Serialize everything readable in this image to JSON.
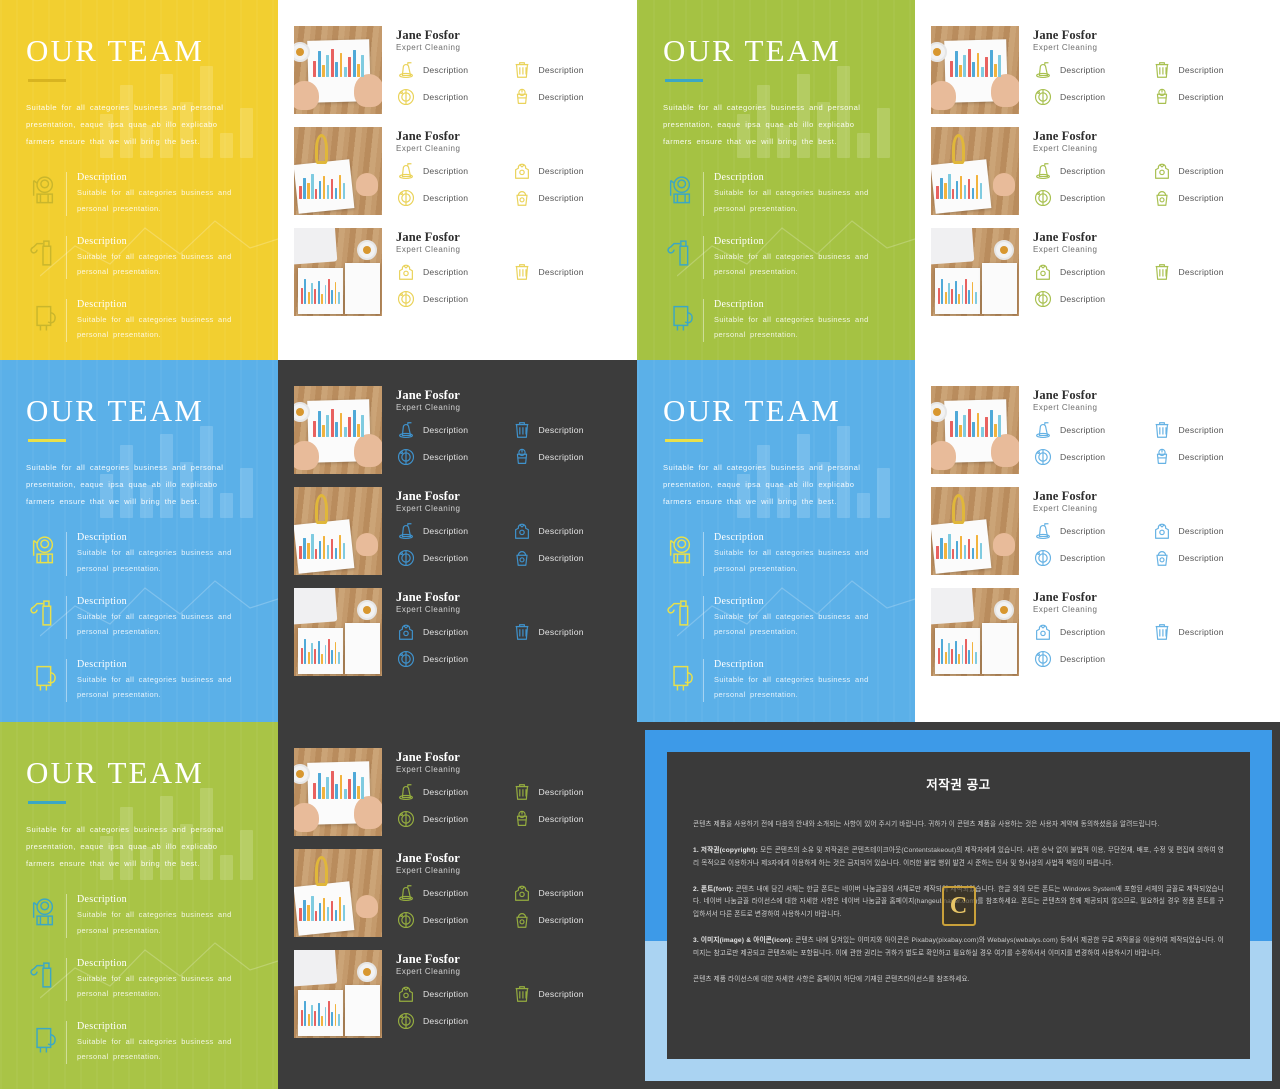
{
  "deck": {
    "title": "OUR TEAM",
    "blurb": "Suitable for all categories business and personal presentation, eaque ipsa quae ab illo explicabo farmers ensure that we will bring the best.",
    "feature_heading": "Description",
    "feature_body": "Suitable for all categories business and personal presentation.",
    "member_name": "Jane Fosfor",
    "member_role": "Expert Cleaning",
    "item_label": "Description"
  },
  "slides": [
    {
      "id": "slide-yellow",
      "panel_color": "#f2cf30",
      "rule_color": "#d8b420",
      "right_theme": "white",
      "icon_color": "#ead35a",
      "feature_icon_color": "#c9b62c"
    },
    {
      "id": "slide-green",
      "panel_color": "#a5c243",
      "rule_color": "#3ba7c4",
      "right_theme": "white",
      "icon_color": "#a8c050",
      "feature_icon_color": "#3ba7c4"
    },
    {
      "id": "slide-blue-dark",
      "panel_color": "#5bb0e8",
      "rule_color": "#e9e04a",
      "right_theme": "dark",
      "icon_color": "#3f92cc",
      "feature_icon_color": "#e9e04a"
    },
    {
      "id": "slide-blue-white",
      "panel_color": "#5bb0e8",
      "rule_color": "#e9e04a",
      "right_theme": "white",
      "icon_color": "#66b2e4",
      "feature_icon_color": "#e9e04a"
    },
    {
      "id": "slide-green-dark",
      "panel_color": "#a9c446",
      "rule_color": "#3ba7c4",
      "right_theme": "dark",
      "icon_color": "#95ad3f",
      "feature_icon_color": "#3ba7c4"
    }
  ],
  "members": [
    {
      "photo": "chart-paper-hands",
      "items": [
        {
          "icon": "vacuum-cleaner-icon"
        },
        {
          "icon": "trash-bin-icon"
        },
        {
          "icon": "washing-machine-icon"
        },
        {
          "icon": "mop-bucket-icon"
        }
      ]
    },
    {
      "photo": "chart-paper-key",
      "items": [
        {
          "icon": "vacuum-cleaner-icon"
        },
        {
          "icon": "apron-icon"
        },
        {
          "icon": "washing-machine-icon"
        },
        {
          "icon": "bucket-icon"
        }
      ]
    },
    {
      "photo": "laptop-coffee-charts",
      "items": [
        {
          "icon": "apron-icon"
        },
        {
          "icon": "trash-bin-icon"
        },
        {
          "icon": "washing-machine-icon"
        }
      ]
    }
  ],
  "features": [
    {
      "icon": "cleaner-person-icon"
    },
    {
      "icon": "spray-bottle-icon"
    },
    {
      "icon": "hand-wipe-icon"
    }
  ],
  "copyright": {
    "title": "저작권 공고",
    "intro": "콘텐츠 제품을 사용하기 전에 다음의 안내와 소개되는 사항이 있어 주시기 바랍니다. 귀하가 이 콘텐츠 제품을 사용하는 것은 사용자 계약에 동의하셨음을 알려드립니다.",
    "p1_label": "1. 저작권(copyright):",
    "p1": "모든 콘텐츠의 소유 및 저작권은 콘텐츠테이크아웃(Contentstakeout)의 제작자에게 있습니다. 사전 승낙 없이 불법적 이용, 무단전재, 배포, 수정 및 편집에 의하여 영리 목적으로 이용하거나 제3자에게 이용하게 하는 것은 금지되어 있습니다. 이러한 불법 행위 발견 시 준하는 민사 및 형사상의 사법적 책임이 따릅니다.",
    "p2_label": "2. 폰트(font):",
    "p2": "콘텐츠 내에 담긴 서체는 한글 폰트는 네이버 나눔글꼴의 서체로만 제작되어 제작되었습니다. 한글 외의 모든 폰트는 Windows System에 포함된 서체의 글꼴로 제작되었습니다. 네이버 나눔글꼴 라이선스에 대한 자세한 사항은 네이버 나눔글꼴 홈페이지(hangeul.naver.com)를 참조하세요. 폰트는 콘텐츠와 함께 제공되지 않으므로, 필요하실 경우 정품 폰트를 구입하셔서 다른 폰트로 변경하여 사용하시기 바랍니다.",
    "p3_label": "3. 이미지(image) & 아이콘(icon):",
    "p3": "콘텐츠 내에 담겨있는 이미지와 아이콘은 Pixabay(pixabay.com)와 Webalys(webalys.com) 등에서 제공한 무료 저작물을 이용하여 제작되었습니다. 이미지는 참고로만 제공되고 콘텐츠에는 포함됩니다. 이에 관한 권리는 귀하가 별도로 확인하고 필요하실 경우 여기를 수정하셔서 이미지를 변경하여 사용하시기 바랍니다.",
    "footer": "콘텐츠 제품 라이선스에 대한 자세한 사항은 홈페이지 하단에 기재된 콘텐츠라이선스를 참조하세요.",
    "logo_letter": "C"
  }
}
